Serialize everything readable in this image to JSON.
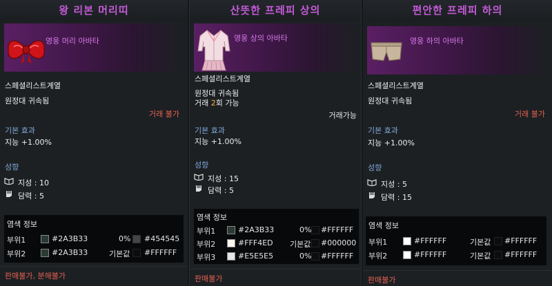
{
  "panels": [
    {
      "title": "왕 리본 머리띠",
      "avatar_label": "영웅 머리 아바타",
      "category": "스페셜리스트계열",
      "bound": "원정대 귀속됨",
      "trade_status": "거래 불가",
      "base_effect_label": "기본 효과",
      "base_effect_value": "지능 +1.00%",
      "tendency_label": "성향",
      "tendency": [
        {
          "icon": "book-icon",
          "label": "지성 : 10"
        },
        {
          "icon": "fist-icon",
          "label": "담력 : 5"
        }
      ],
      "dye_title": "염색 정보",
      "dye_rows": [
        {
          "part": "부위1",
          "color": "#2A3B33",
          "swatch": "#2a3b33",
          "pct": "0%",
          "target": "#454545",
          "target_swatch": "#454545"
        },
        {
          "part": "부위2",
          "color": "#2A3B33",
          "swatch": "#2a3b33",
          "pct": "기본값",
          "target": "#FFFFFF",
          "target_swatch": ""
        }
      ],
      "footer": "판매불가, 분해불가"
    },
    {
      "title": "산뜻한 프레피 상의",
      "avatar_label": "영웅 상의 아바타",
      "category": "스페셜리스트계열",
      "bound": "원정대 귀속됨",
      "trade_count_prefix": "거래 ",
      "trade_count_number": "2",
      "trade_count_suffix": "회 가능",
      "trade_status": "거래가능",
      "base_effect_label": "기본 효과",
      "base_effect_value": "지능 +1.00%",
      "tendency_label": "성향",
      "tendency": [
        {
          "icon": "book-icon",
          "label": "지성 : 15"
        },
        {
          "icon": "fist-icon",
          "label": "담력 : 5"
        }
      ],
      "dye_title": "염색 정보",
      "dye_rows": [
        {
          "part": "부위1",
          "color": "#2A3B33",
          "swatch": "#2a3b33",
          "pct": "0%",
          "target": "#FFFFFF",
          "target_swatch": ""
        },
        {
          "part": "부위2",
          "color": "#FFF4ED",
          "swatch": "#fff4ed",
          "pct": "기본값",
          "target": "#000000",
          "target_swatch": ""
        },
        {
          "part": "부위3",
          "color": "#E5E5E5",
          "swatch": "#e5e5e5",
          "pct": "0%",
          "target": "#FFFFFF",
          "target_swatch": ""
        }
      ],
      "footer": "판매불가"
    },
    {
      "title": "편안한 프레피 하의",
      "avatar_label": "영웅 하의 아바타",
      "category": "스페셜리스트계열",
      "bound": "원정대 귀속됨",
      "trade_status": "거래 불가",
      "base_effect_label": "기본 효과",
      "base_effect_value": "지능 +1.00%",
      "tendency_label": "성향",
      "tendency": [
        {
          "icon": "book-icon",
          "label": "지성 : 5"
        },
        {
          "icon": "fist-icon",
          "label": "담력 : 15"
        }
      ],
      "dye_title": "염색 정보",
      "dye_rows": [
        {
          "part": "부위1",
          "color": "#FFFFFF",
          "swatch": "#ffffff",
          "pct": "기본값",
          "target": "#FFFFFF",
          "target_swatch": ""
        },
        {
          "part": "부위2",
          "color": "#FFFFFF",
          "swatch": "#ffffff",
          "pct": "기본값",
          "target": "#FFFFFF",
          "target_swatch": ""
        }
      ],
      "footer": "판매불가"
    }
  ]
}
